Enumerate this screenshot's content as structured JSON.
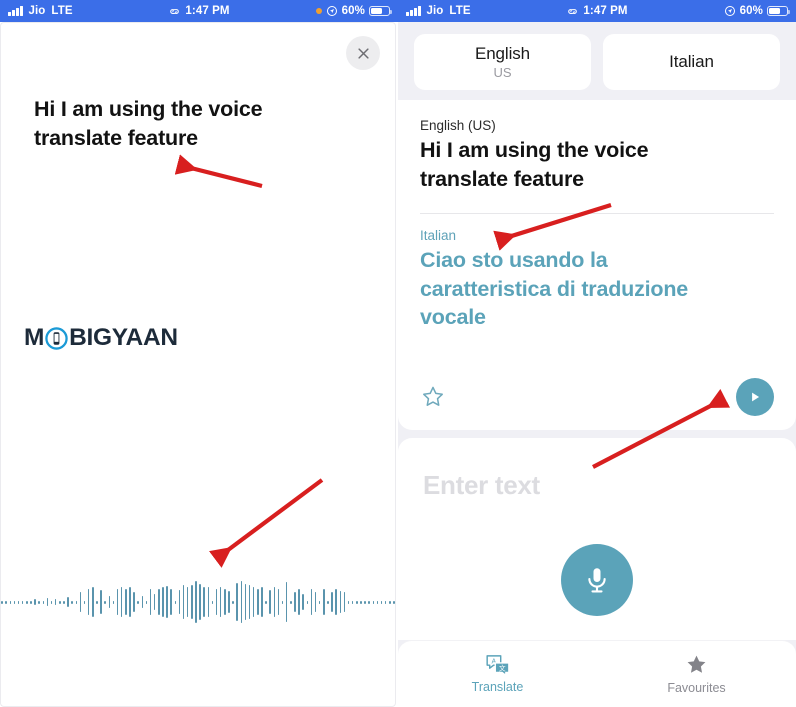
{
  "status_bar": {
    "carrier": "Jio",
    "network": "LTE",
    "time": "1:47 PM",
    "battery_percent": "60%",
    "link_icon": "chain-link-icon",
    "location_icon": "location-icon",
    "recording_dot_color": "#f0a030",
    "background": "#3b6ee8"
  },
  "left_screen": {
    "close_label": "close",
    "spoken_text": "Hi I am using the voice translate feature",
    "watermark": {
      "prefix": "M",
      "suffix": "BIGYAAN",
      "full": "MOBIGYAAN",
      "accent": "#1b9ad6"
    },
    "waveform": {
      "bar_color": "#5a94ad",
      "heights": [
        3,
        3,
        3,
        3,
        3,
        3,
        3,
        3,
        6,
        3,
        3,
        8,
        3,
        6,
        3,
        3,
        10,
        3,
        3,
        20,
        3,
        26,
        30,
        3,
        24,
        3,
        12,
        3,
        26,
        30,
        26,
        30,
        20,
        3,
        12,
        3,
        26,
        16,
        26,
        30,
        32,
        26,
        3,
        24,
        34,
        30,
        34,
        42,
        36,
        30,
        30,
        3,
        26,
        30,
        26,
        22,
        3,
        38,
        42,
        36,
        34,
        30,
        26,
        30,
        3,
        24,
        30,
        26,
        3,
        40,
        3,
        20,
        26,
        16,
        3,
        26,
        20,
        3,
        26,
        3,
        20,
        26,
        22,
        20,
        3,
        3,
        3,
        3,
        3,
        3,
        3,
        3,
        3,
        3,
        3,
        3
      ]
    }
  },
  "right_screen": {
    "languages": {
      "source": {
        "name": "English",
        "region": "US"
      },
      "target": {
        "name": "Italian",
        "region": ""
      }
    },
    "result": {
      "source_label": "English (US)",
      "source_text": "Hi I am using the voice translate feature",
      "target_label": "Italian",
      "target_text": "Ciao sto usando la caratteristica di traduzione vocale",
      "favourite_icon": "star-outline-icon",
      "play_icon": "play-icon",
      "accent_color": "#5ba3b9"
    },
    "input": {
      "placeholder": "Enter text",
      "mic_icon": "microphone-icon"
    },
    "tabs": [
      {
        "label": "Translate",
        "icon": "translate-icon",
        "active": true
      },
      {
        "label": "Favourites",
        "icon": "star-filled-icon",
        "active": false
      }
    ]
  },
  "annotations": {
    "arrow_color": "#d81f1f",
    "arrows": [
      "arrow-to-spoken-text",
      "arrow-to-waveform",
      "arrow-to-italian-label",
      "arrow-to-play-button"
    ]
  }
}
